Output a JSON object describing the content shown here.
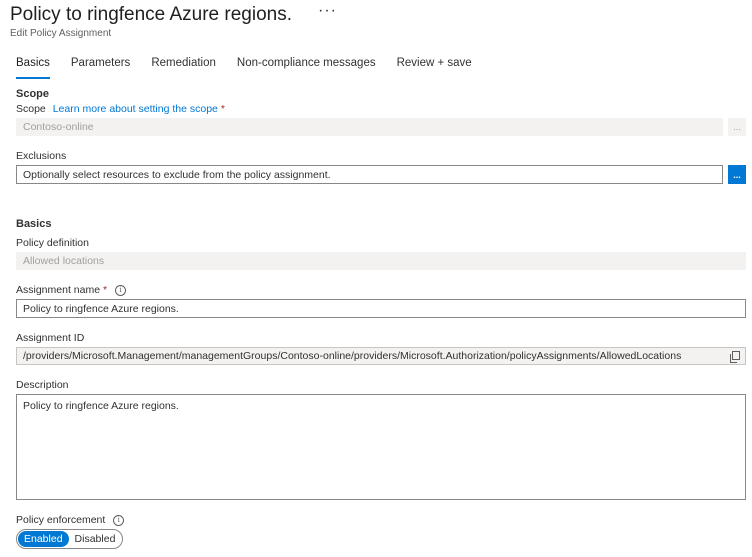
{
  "header": {
    "title": "Policy to ringfence Azure regions.",
    "more_icon": "ellipsis-icon",
    "subtitle": "Edit Policy Assignment"
  },
  "tabs": [
    {
      "label": "Basics",
      "active": true
    },
    {
      "label": "Parameters"
    },
    {
      "label": "Remediation"
    },
    {
      "label": "Non-compliance messages"
    },
    {
      "label": "Review + save"
    }
  ],
  "scope": {
    "heading": "Scope",
    "label": "Scope",
    "link": "Learn more about setting the scope",
    "required_mark": "*",
    "value": "Contoso-online",
    "button": "..."
  },
  "exclusions": {
    "label": "Exclusions",
    "placeholder": "Optionally select resources to exclude from the policy assignment.",
    "button": "..."
  },
  "basics": {
    "heading": "Basics",
    "policy_definition_label": "Policy definition",
    "policy_definition_value": "Allowed locations",
    "assignment_name_label": "Assignment name",
    "required_mark": "*",
    "assignment_name_value": "Policy to ringfence Azure regions.",
    "assignment_id_label": "Assignment ID",
    "assignment_id_value": "/providers/Microsoft.Management/managementGroups/Contoso-online/providers/Microsoft.Authorization/policyAssignments/AllowedLocations",
    "description_label": "Description",
    "description_value": "Policy to ringfence Azure regions.",
    "policy_enforcement_label": "Policy enforcement",
    "enforcement_options": [
      "Enabled",
      "Disabled"
    ],
    "enforcement_selected": "Enabled"
  },
  "colors": {
    "accent": "#0078d4",
    "required": "#a4262c",
    "disabled_bg": "#f3f2f1"
  }
}
